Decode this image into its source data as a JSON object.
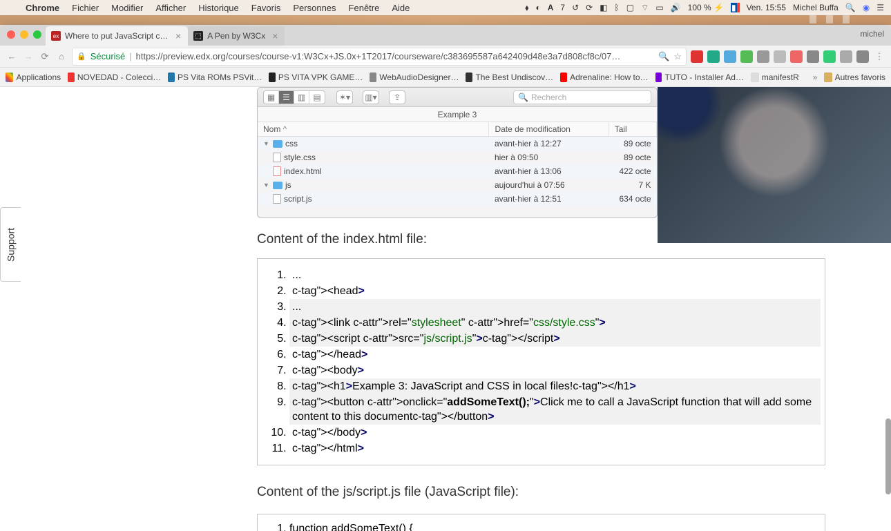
{
  "mac": {
    "app": "Chrome",
    "menus": [
      "Fichier",
      "Modifier",
      "Afficher",
      "Historique",
      "Favoris",
      "Personnes",
      "Fenêtre",
      "Aide"
    ],
    "battery": "100 %",
    "clock": "Ven. 15:55",
    "user": "Michel Buffa"
  },
  "chrome": {
    "profile": "michel",
    "tabs": [
      {
        "title": "Where to put JavaScript code",
        "active": true
      },
      {
        "title": "A Pen by W3Cx",
        "active": false
      }
    ],
    "secure_label": "Sécurisé",
    "url": "https://preview.edx.org/courses/course-v1:W3Cx+JS.0x+1T2017/courseware/c383695587a642409d48e3a7d808cf8c/07…",
    "bookmarks_label": "Applications",
    "bookmarks": [
      "NOVEDAD - Colecci…",
      "PS Vita ROMs PSVit…",
      "PS VITA VPK GAME…",
      "WebAudioDesigner…",
      "The Best Undiscov…",
      "Adrenaline: How to…",
      "TUTO - Installer Ad…",
      "manifestR"
    ],
    "other_bm": "Autres favoris"
  },
  "support": "Support",
  "finder": {
    "crumb": "Example 3",
    "search_placeholder": "Recherch",
    "cols": {
      "name": "Nom",
      "mod": "Date de modification",
      "size": "Tail"
    },
    "rows": [
      {
        "name": "css",
        "mod": "avant-hier à 12:27",
        "size": "89 octe",
        "type": "folder",
        "indent": 1,
        "open": true
      },
      {
        "name": "style.css",
        "mod": "hier à 09:50",
        "size": "89 octe",
        "type": "file",
        "indent": 2
      },
      {
        "name": "index.html",
        "mod": "avant-hier à 13:06",
        "size": "422 octe",
        "type": "html",
        "indent": 1
      },
      {
        "name": "js",
        "mod": "aujourd'hui à 07:56",
        "size": "7 K",
        "type": "folder",
        "indent": 1,
        "open": true
      },
      {
        "name": "script.js",
        "mod": "avant-hier à 12:51",
        "size": "634 octe",
        "type": "file",
        "indent": 2
      }
    ]
  },
  "content": {
    "h1": "Content of the index.html file:",
    "h2": "Content of the js/script.js file (JavaScript file):",
    "code1": [
      "...",
      "<head>",
      "   ...",
      "   <link rel=\"stylesheet\" href=\"css/style.css\">",
      "   <script src=\"js/script.js\"></script>",
      "</head>",
      "<body>",
      "<h1>Example 3: JavaScript and CSS in local files!</h1>",
      "<button onclick=\"addSomeText();\">Click me to call a JavaScript function that will add some content to this document</button>",
      "</body>",
      "</html>"
    ],
    "code2": "function addSomeText() {"
  }
}
